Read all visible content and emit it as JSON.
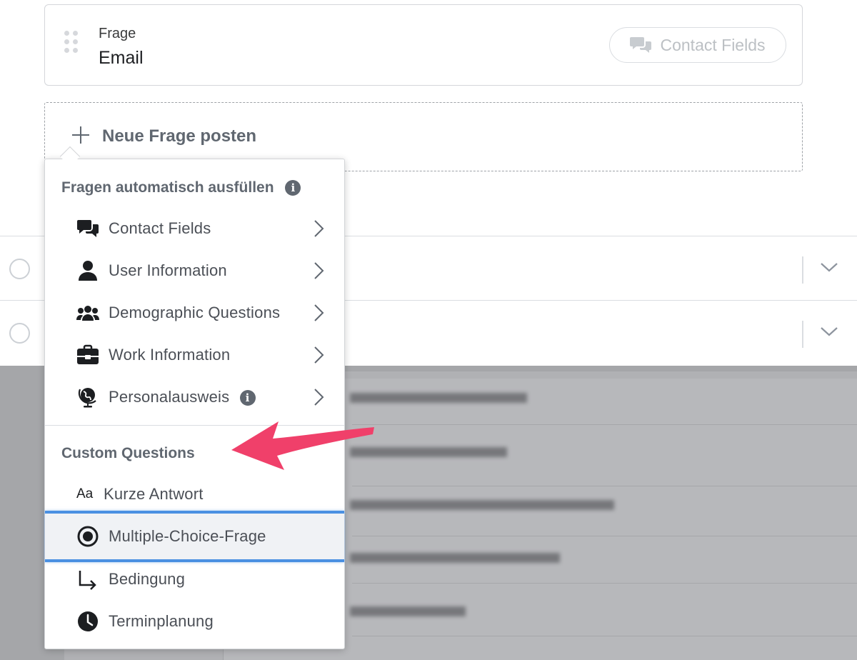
{
  "question_card": {
    "label": "Frage",
    "value": "Email",
    "badge_label": "Contact Fields",
    "badge_icon": "chat-bubbles-icon"
  },
  "new_question": {
    "label": "Neue Frage posten",
    "icon": "plus-icon"
  },
  "menu": {
    "autofill_header": "Fragen automatisch ausfüllen",
    "autofill_items": [
      {
        "label": "Contact Fields",
        "icon": "chat-bubbles-icon"
      },
      {
        "label": "User Information",
        "icon": "user-icon"
      },
      {
        "label": "Demographic Questions",
        "icon": "users-group-icon"
      },
      {
        "label": "Work Information",
        "icon": "briefcase-icon"
      },
      {
        "label": "Personalausweis",
        "icon": "globe-icon",
        "info": true
      }
    ],
    "custom_header": "Custom Questions",
    "custom_items": [
      {
        "label": "Kurze Antwort",
        "icon": "text-aa-icon"
      },
      {
        "label": "Multiple-Choice-Frage",
        "icon": "radio-selected-icon",
        "selected": true
      },
      {
        "label": "Bedingung",
        "icon": "conditional-arrow-icon"
      },
      {
        "label": "Terminplanung",
        "icon": "clock-icon"
      }
    ]
  },
  "colors": {
    "selection_border": "#4a90e2",
    "annotation_arrow": "#f0406a",
    "text_muted": "#606770"
  }
}
